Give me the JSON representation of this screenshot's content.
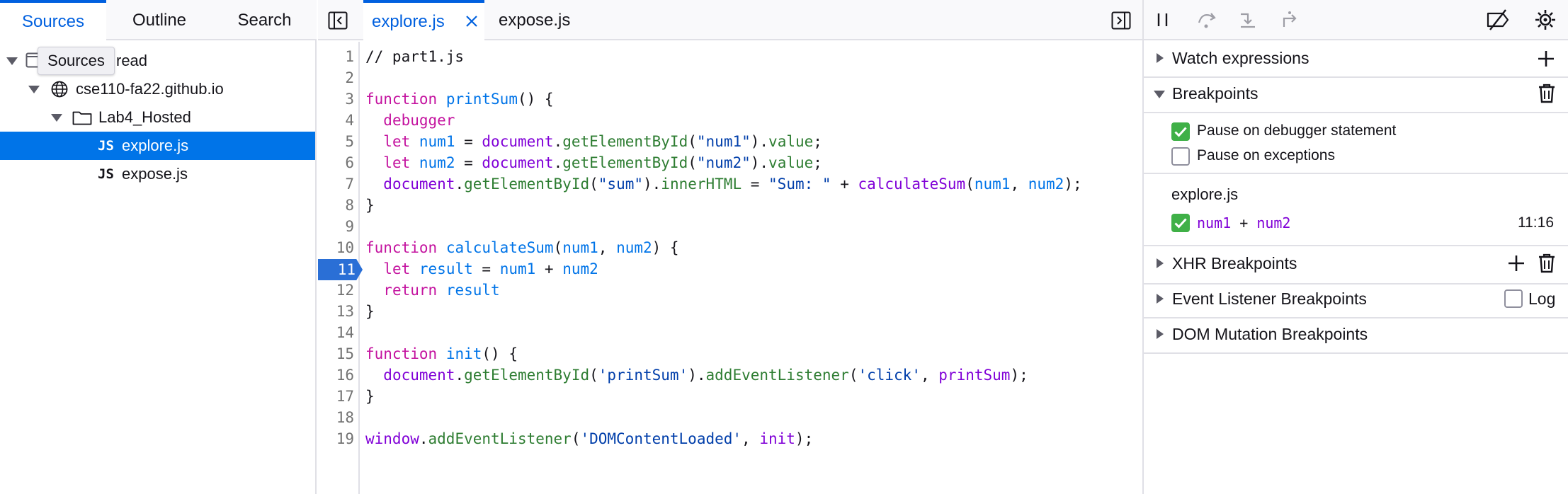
{
  "left_panel": {
    "tabs": [
      "Sources",
      "Outline",
      "Search"
    ],
    "tooltip": "Sources",
    "tree": {
      "thread_label": "Main Thread",
      "thread_visible": "read",
      "domain": "cse110-fa22.github.io",
      "folder": "Lab4_Hosted",
      "files": [
        "explore.js",
        "expose.js"
      ],
      "badge": "JS"
    }
  },
  "editor": {
    "tabs": [
      "explore.js",
      "expose.js"
    ],
    "active_tab": "explore.js",
    "breakpoint_line": "11",
    "line_numbers": [
      "1",
      "2",
      "3",
      "4",
      "5",
      "6",
      "7",
      "8",
      "9",
      "10",
      "11",
      "12",
      "13",
      "14",
      "15",
      "16",
      "17",
      "18",
      "19"
    ]
  },
  "right_panel": {
    "sections": {
      "watch": "Watch expressions",
      "breakpoints": "Breakpoints",
      "xhr": "XHR Breakpoints",
      "event_listener": "Event Listener Breakpoints",
      "dom_mutation": "DOM Mutation Breakpoints"
    },
    "options": {
      "pause_debugger": "Pause on debugger statement",
      "pause_debugger_checked": true,
      "pause_exceptions": "Pause on exceptions",
      "pause_exceptions_checked": false
    },
    "bp_file": "explore.js",
    "bp_expr_a": "num1",
    "bp_expr_op": "+",
    "bp_expr_b": "num2",
    "bp_location": "11:16",
    "log_label": "Log"
  },
  "colors": {
    "accent": "#0060df",
    "selection": "#0074e8",
    "breakpoint": "#2a6fd6",
    "check_green": "#3fb047"
  }
}
